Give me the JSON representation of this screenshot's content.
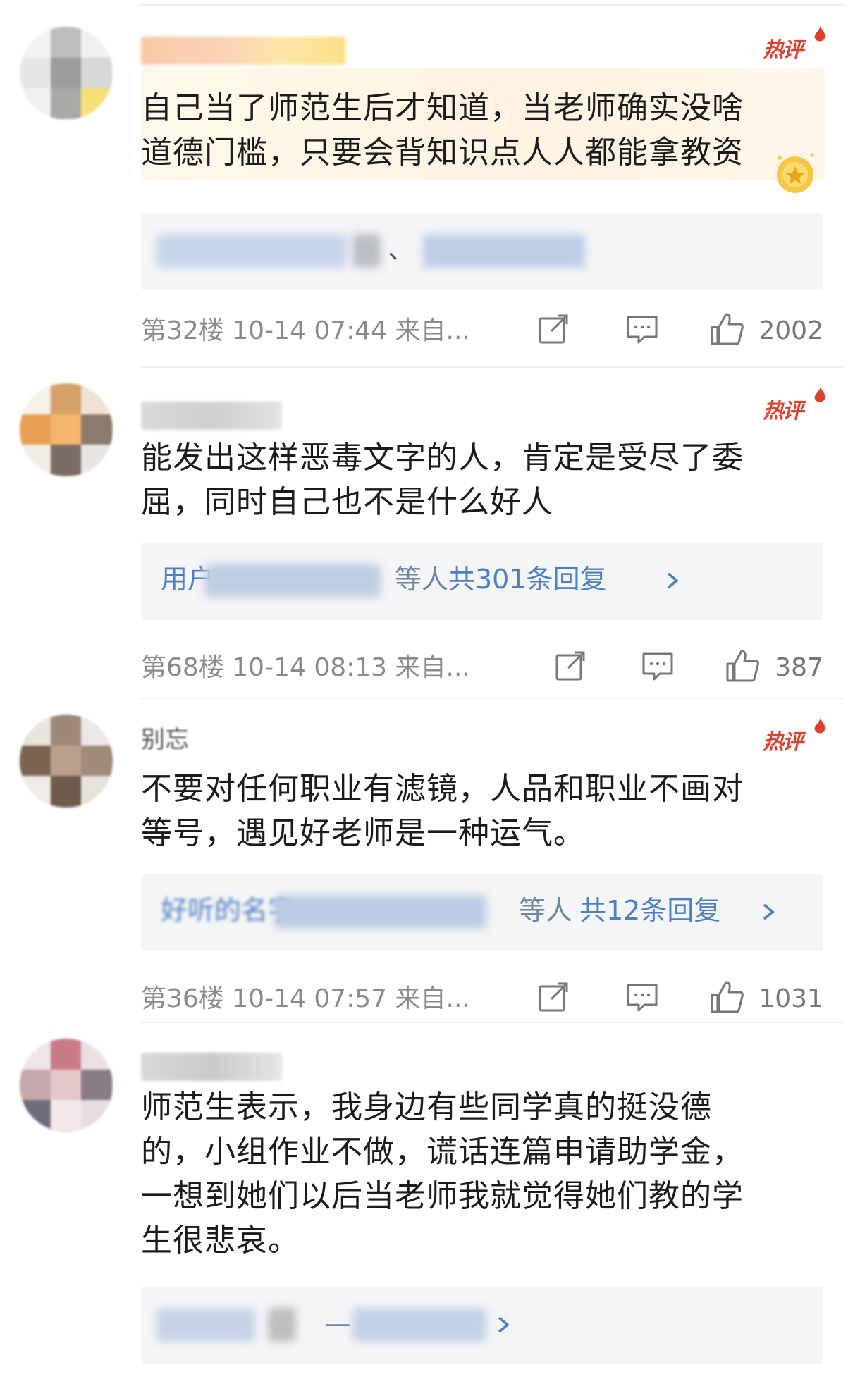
{
  "colors": {
    "hot": "#e0412c",
    "link": "#4d7fc5",
    "meta": "#8a8a8a"
  },
  "comments": [
    {
      "badge": "热评",
      "text_lines": [
        "自己当了师范生后才知道，当老师确实没啥",
        "道德门槛，只要会背知识点人人都能拿教资"
      ],
      "reply_visible": "、",
      "floor": "第32楼",
      "time": "10-14 07:44",
      "source": "来自...",
      "likes": "2002",
      "icons": [
        "share-icon",
        "comment-icon",
        "like-icon"
      ]
    },
    {
      "badge": "热评",
      "text_lines": [
        "能发出这样恶毒文字的人，肯定是受尽了委",
        "屈，同时自己也不是什么好人"
      ],
      "reply_prefix": "用户",
      "reply_mid": "等人",
      "reply_total": "共301条回复",
      "floor": "第68楼",
      "time": "10-14 08:13",
      "source": "来自...",
      "likes": "387",
      "icons": [
        "share-icon",
        "comment-icon",
        "like-icon"
      ]
    },
    {
      "badge": "热评",
      "username_partial": "别忘",
      "text_lines": [
        "不要对任何职业有滤镜，人品和职业不画对",
        "等号，遇见好老师是一种运气。"
      ],
      "reply_prefix": "好听的名字",
      "reply_mid": "等人",
      "reply_total": "共12条回复",
      "floor": "第36楼",
      "time": "10-14 07:57",
      "source": "来自...",
      "likes": "1031",
      "icons": [
        "share-icon",
        "comment-icon",
        "like-icon"
      ]
    },
    {
      "text_lines": [
        "师范生表示，我身边有些同学真的挺没德",
        "的，小组作业不做，谎话连篇申请助学金，",
        "一想到她们以后当老师我就觉得她们教的学",
        "生很悲哀。"
      ],
      "reply_visible": "—",
      "icons": []
    }
  ]
}
